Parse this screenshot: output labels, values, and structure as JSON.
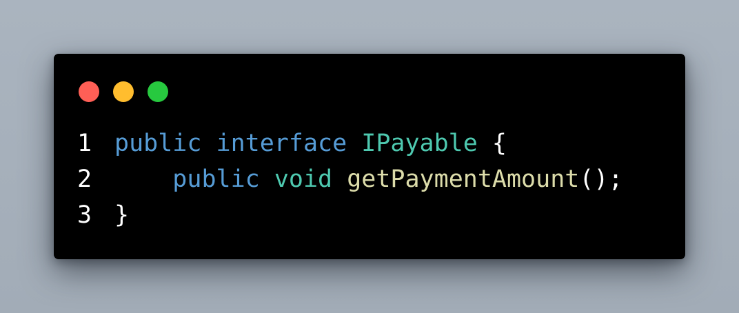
{
  "window_controls": {
    "close_color": "#ff5f56",
    "minimize_color": "#ffbd2e",
    "maximize_color": "#27c93f"
  },
  "code": {
    "lines": [
      {
        "number": "1",
        "tokens": [
          {
            "text": "public",
            "color": "#569cd6"
          },
          {
            "text": " ",
            "color": "#d4d4d4"
          },
          {
            "text": "interface",
            "color": "#569cd6"
          },
          {
            "text": " ",
            "color": "#d4d4d4"
          },
          {
            "text": "IPayable",
            "color": "#4ec9b0"
          },
          {
            "text": " ",
            "color": "#d4d4d4"
          },
          {
            "text": "{",
            "color": "#ffffff"
          }
        ]
      },
      {
        "number": "2",
        "tokens": [
          {
            "text": "    ",
            "color": "#d4d4d4"
          },
          {
            "text": "public",
            "color": "#569cd6"
          },
          {
            "text": " ",
            "color": "#d4d4d4"
          },
          {
            "text": "void",
            "color": "#4ec9b0"
          },
          {
            "text": " ",
            "color": "#d4d4d4"
          },
          {
            "text": "getPaymentAmount",
            "color": "#dcdcaa"
          },
          {
            "text": "();",
            "color": "#ffffff"
          }
        ]
      },
      {
        "number": "3",
        "tokens": [
          {
            "text": "}",
            "color": "#ffffff"
          }
        ]
      }
    ]
  }
}
